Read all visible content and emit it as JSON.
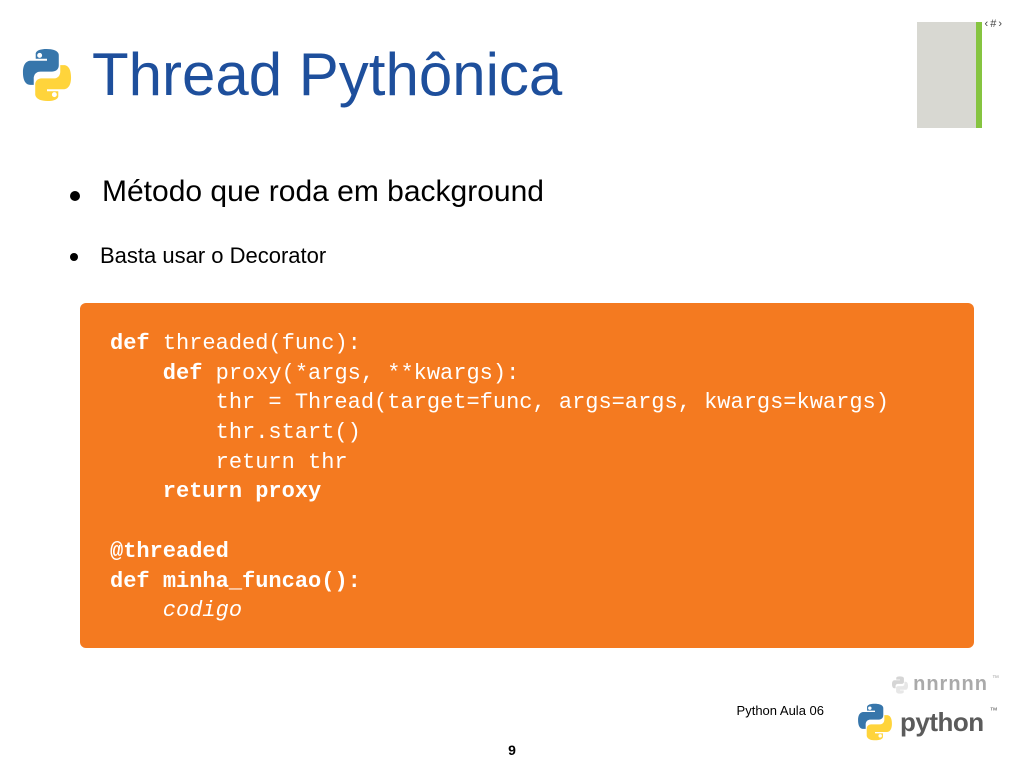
{
  "page_marker": "‹#›",
  "title": "Thread Pythônica",
  "bullets": [
    {
      "text": "Método que roda em background",
      "size": "large"
    },
    {
      "text": "Basta usar o Decorator",
      "size": "small"
    }
  ],
  "code": {
    "lines": [
      {
        "segments": [
          {
            "t": "def ",
            "c": "kw"
          },
          {
            "t": "threaded(func):",
            "c": "plain"
          }
        ]
      },
      {
        "segments": [
          {
            "t": "    def ",
            "c": "kw"
          },
          {
            "t": "proxy(*args, **kwargs):",
            "c": "plain"
          }
        ]
      },
      {
        "segments": [
          {
            "t": "        thr = Thread(target=func, args=args, kwargs=kwargs)",
            "c": "plain"
          }
        ]
      },
      {
        "segments": [
          {
            "t": "        thr.start()",
            "c": "plain"
          }
        ]
      },
      {
        "segments": [
          {
            "t": "        return thr",
            "c": "plain"
          }
        ]
      },
      {
        "segments": [
          {
            "t": "    return ",
            "c": "kw"
          },
          {
            "t": "proxy",
            "c": "id"
          }
        ]
      },
      {
        "segments": [
          {
            "t": " ",
            "c": "plain"
          }
        ]
      },
      {
        "segments": [
          {
            "t": "@threaded",
            "c": "id"
          }
        ]
      },
      {
        "segments": [
          {
            "t": "def ",
            "c": "kw"
          },
          {
            "t": "minha_funcao():",
            "c": "id"
          }
        ]
      },
      {
        "segments": [
          {
            "t": "    codigo",
            "c": "italic"
          }
        ]
      }
    ]
  },
  "footer": {
    "course": "Python  Aula 06",
    "page": "9",
    "logo_text": "python",
    "logo_tm": "™"
  }
}
